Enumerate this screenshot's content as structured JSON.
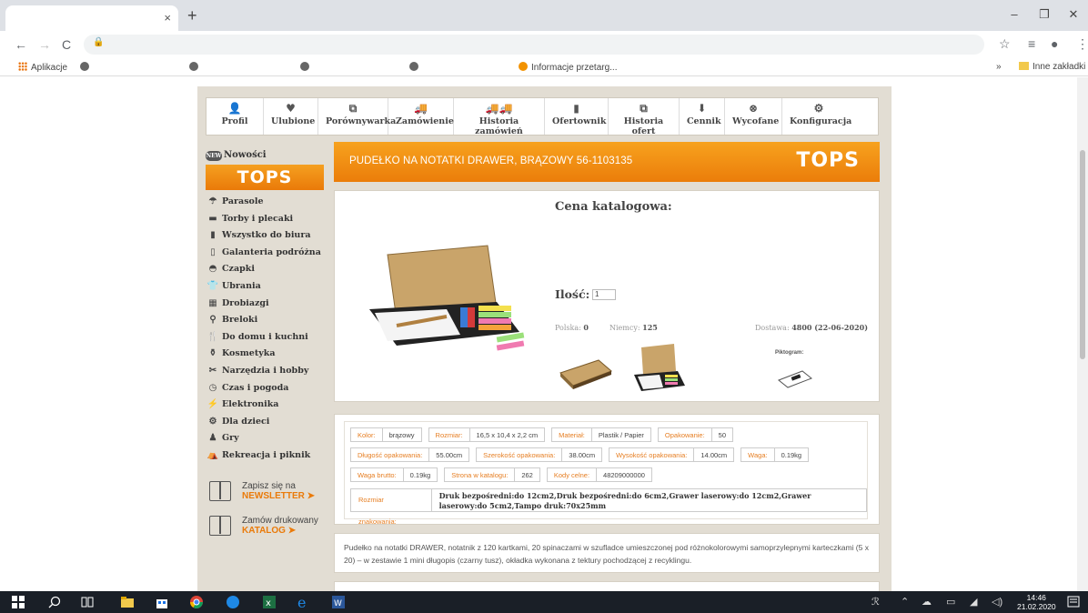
{
  "browser": {
    "tab_close": "×",
    "new_tab": "+",
    "window_controls": {
      "minimize": "–",
      "restore": "❐",
      "close": "✕"
    },
    "nav": {
      "back": "←",
      "forward": "→",
      "reload": "C",
      "lock": "🔒"
    },
    "toolbar_icons": {
      "star": "☆",
      "reading_list": "≡",
      "account": "●",
      "menu": "⋮"
    },
    "bookmarks": {
      "apps": "Aplikacje",
      "informacje": "Informacje przetarg...",
      "more": "»",
      "other": "Inne zakładki"
    }
  },
  "topnav": [
    {
      "label": "Profil",
      "icon": "user-icon",
      "glyph": "👤"
    },
    {
      "label": "Ulubione",
      "icon": "heart-icon",
      "glyph": "♥"
    },
    {
      "label": "Porównywarka",
      "icon": "compare-icon",
      "glyph": "⧉"
    },
    {
      "label": "Zamówienie",
      "icon": "truck-icon",
      "glyph": "🚚"
    },
    {
      "label": "Historia zamówień",
      "icon": "trucks-icon",
      "glyph": "🚚🚚"
    },
    {
      "label": "Ofertownik",
      "icon": "document-icon",
      "glyph": "▮"
    },
    {
      "label": "Historia ofert",
      "icon": "documents-icon",
      "glyph": "⧉"
    },
    {
      "label": "Cennik",
      "icon": "download-icon",
      "glyph": "⬇"
    },
    {
      "label": "Wycofane",
      "icon": "cancel-icon",
      "glyph": "⊗"
    },
    {
      "label": "Konfiguracja",
      "icon": "gears-icon",
      "glyph": "⚙"
    }
  ],
  "sidebar": {
    "news": "Nowości",
    "news_badge": "NEW",
    "logo": "TOPS",
    "categories": [
      {
        "label": "Parasole",
        "icon": "umbrella-icon",
        "glyph": "☂"
      },
      {
        "label": "Torby i plecaki",
        "icon": "bag-icon",
        "glyph": "▬"
      },
      {
        "label": "Wszystko do biura",
        "icon": "binder-icon",
        "glyph": "▮"
      },
      {
        "label": "Galanteria podróżna",
        "icon": "suitcase-icon",
        "glyph": "▯"
      },
      {
        "label": "Czapki",
        "icon": "cap-icon",
        "glyph": "◓"
      },
      {
        "label": "Ubrania",
        "icon": "shirt-icon",
        "glyph": "👕"
      },
      {
        "label": "Drobiazgi",
        "icon": "box-icon",
        "glyph": "▦"
      },
      {
        "label": "Breloki",
        "icon": "keychain-icon",
        "glyph": "⚲"
      },
      {
        "label": "Do domu i kuchni",
        "icon": "kitchen-icon",
        "glyph": "🍴"
      },
      {
        "label": "Kosmetyka",
        "icon": "cosmetics-icon",
        "glyph": "⚱"
      },
      {
        "label": "Narzędzia i hobby",
        "icon": "tools-icon",
        "glyph": "✂"
      },
      {
        "label": "Czas i pogoda",
        "icon": "clock-icon",
        "glyph": "◷"
      },
      {
        "label": "Elektronika",
        "icon": "plug-icon",
        "glyph": "⚡"
      },
      {
        "label": "Dla dzieci",
        "icon": "toys-icon",
        "glyph": "⚙"
      },
      {
        "label": "Gry",
        "icon": "pawn-icon",
        "glyph": "♟"
      },
      {
        "label": "Rekreacja i piknik",
        "icon": "picnic-icon",
        "glyph": "⛺"
      }
    ],
    "newsletter": {
      "line1": "Zapisz się na",
      "line2": "NEWSLETTER ➤"
    },
    "catalog": {
      "line1": "Zamów drukowany",
      "line2": "KATALOG ➤"
    }
  },
  "product": {
    "title": "PUDEŁKO NA NOTATKI DRAWER, BRĄZOWY 56-1103135",
    "logo": "TOPS",
    "price_label": "Cena katalogowa:",
    "qty_label": "Ilość:",
    "qty_value": "1",
    "stock": {
      "poland_label": "Polska:",
      "poland_value": "0",
      "germany_label": "Niemcy:",
      "germany_value": "125",
      "delivery_label": "Dostawa:",
      "delivery_value": "4800 (22-06-2020)"
    },
    "pictogram_label": "Piktogram:"
  },
  "specs": {
    "row1": [
      {
        "label": "Kolor:",
        "value": "brązowy"
      },
      {
        "label": "Rozmiar:",
        "value": "16,5 x 10,4 x 2,2 cm"
      },
      {
        "label": "Materiał:",
        "value": "Plastik / Papier"
      },
      {
        "label": "Opakowanie:",
        "value": "50"
      }
    ],
    "row2": [
      {
        "label": "Długość opakowania:",
        "value": "55.00cm"
      },
      {
        "label": "Szerokość opakowania:",
        "value": "38.00cm"
      },
      {
        "label": "Wysokość opakowania:",
        "value": "14.00cm"
      },
      {
        "label": "Waga:",
        "value": "0.19kg"
      }
    ],
    "row3": [
      {
        "label": "Waga brutto:",
        "value": "0.19kg"
      },
      {
        "label": "Strona w katalogu:",
        "value": "262"
      },
      {
        "label": "Kody celne:",
        "value": "48209000000"
      }
    ],
    "marking_label": "Rozmiar znakowania:",
    "marking_value": "Druk bezpośredni:do 12cm2,Druk bezpośredni:do 6cm2,Grawer laserowy:do 12cm2,Grawer laserowy:do 5cm2,Tampo druk:70x25mm"
  },
  "description": "Pudełko na notatki DRAWER, notatnik z 120 kartkami, 20 spinaczami w szufladce umieszczonej pod różnokolorowymi samoprzylepnymi karteczkami (5 x 20) – w zestawie 1 mini długopis (czarny tusz), okładka wykonana z tektury pochodzącej z recyklingu.",
  "taskbar": {
    "time": "14:46",
    "date": "21.02.2020"
  },
  "colors": {
    "accent_orange": "#ea7a09",
    "page_bg": "#e2ddd3",
    "taskbar": "#1a1f27"
  }
}
